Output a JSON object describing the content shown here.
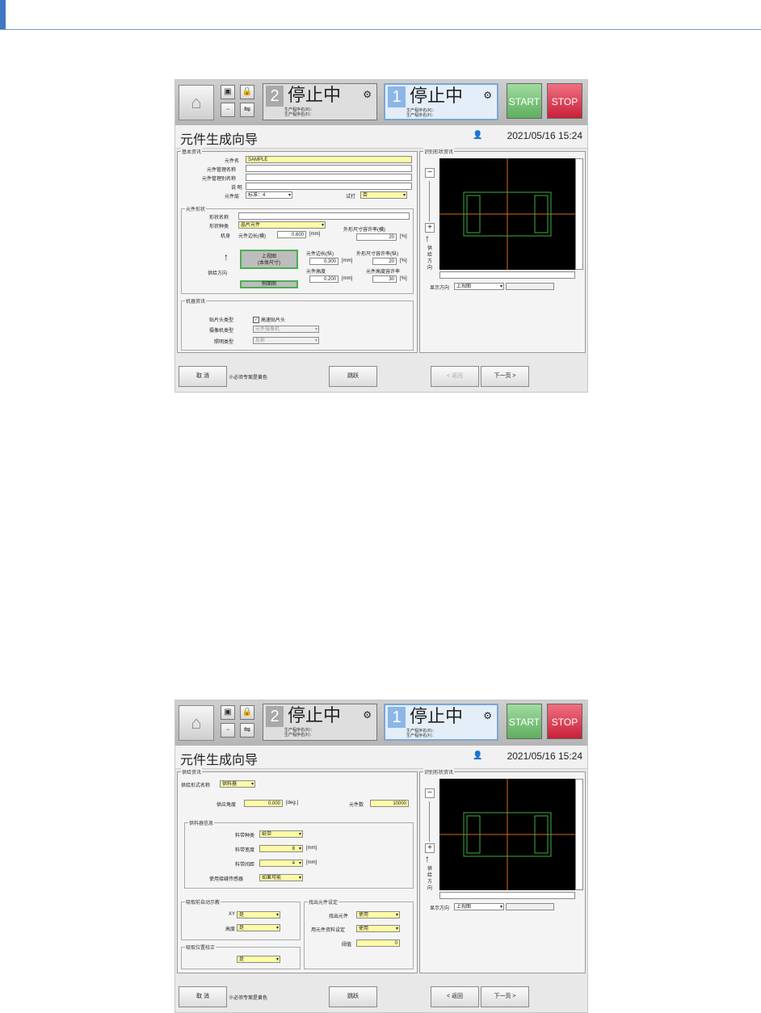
{
  "header": {
    "lane2": {
      "number": "2",
      "status": "停止中",
      "info1": "生产程序名(R)：",
      "info2": "生产程序名(F)："
    },
    "lane1": {
      "number": "1",
      "status": "停止中",
      "info1": "生产程序名(R)：",
      "info2": "生产程序名(F)："
    },
    "start_label": "START",
    "stop_label": "STOP"
  },
  "title": "元件生成向导",
  "datetime": "2021/05/16 15:24",
  "footer": {
    "cancel": "取 消",
    "note": "※必须专案是黄色",
    "skip": "跳跃",
    "back": "< 返回",
    "next": "下一页 >"
  },
  "view_panel": {
    "legend": "识别形状资讯",
    "feed_dir": [
      "供",
      "给",
      "方",
      "向"
    ],
    "display_dir_label": "显示方向",
    "display_dir_value": "上视图"
  },
  "screen1": {
    "basic": {
      "legend": "基本资讯",
      "name_label": "元件名",
      "name_value": "SAMPLE",
      "mgmt_label": "元件管理名称",
      "alias_label": "元件管理别名称",
      "desc_label": "说 明",
      "layer_label": "元件层",
      "layer_value": "标准：4",
      "trial_label": "试打",
      "trial_value": "否"
    },
    "shape": {
      "legend": "元件形状",
      "shape_name_label": "形状名称",
      "shape_type_label": "形状种类",
      "shape_type_value": "晶片元件",
      "body_label": "机身",
      "side_h_label": "元件边长(横)",
      "side_h_value": "0.600",
      "unit_mm": "[mm]",
      "tol_h_label": "外形尺寸容许率(横)",
      "tol_h_value": "20",
      "unit_pct": "[%]",
      "top_view": "上视图",
      "top_view_sub": "(本体尺寸)",
      "side_view": "侧面图",
      "side_v_label": "元件边长(纵)",
      "side_v_value": "0.300",
      "tol_v_label": "外形尺寸容许率(纵)",
      "tol_v_value": "20",
      "height_label": "元件高度",
      "height_value": "0.200",
      "tol_ht_label": "元件高度容许率",
      "tol_ht_value": "30",
      "feed_dir_label": "供给方向"
    },
    "machine": {
      "legend": "机器资讯",
      "head_label": "贴片头类型",
      "head_value": "高速贴片头",
      "camera_label": "摄像机类型",
      "camera_value": "元件摄像机",
      "light_label": "照明类型",
      "light_value": "反射"
    }
  },
  "screen2": {
    "supply": {
      "legend": "供给资讯",
      "format_label": "供给形式名称",
      "format_value": "供料器",
      "angle_label": "供应角度",
      "angle_value": "0.000",
      "angle_unit": "[deg.]",
      "count_label": "元件数",
      "count_value": "10000"
    },
    "feeder": {
      "legend": "供料器信息",
      "tape_type_label": "料带种类",
      "tape_type_value": "纸带",
      "tape_width_label": "料带宽度",
      "tape_width_value": "8",
      "pitch_label": "料带间距",
      "pitch_value": "4",
      "unit_mm": "[mm]",
      "splice_label": "使用接缝传感器",
      "splice_value": "如果可能"
    },
    "auto_teach": {
      "legend": "吸取前自动示教",
      "xy_label": "XY",
      "xy_value": "是",
      "height_label": "高度",
      "height_value": "是"
    },
    "pos_correct": {
      "legend": "吸取位置校正",
      "value": "是"
    },
    "eject": {
      "legend": "找出元件设定",
      "find_label": "找出元件",
      "find_value": "使用",
      "material_label": "用元件资料设定",
      "material_value": "使用",
      "threshold_label": "阈值",
      "threshold_value": "0"
    }
  }
}
